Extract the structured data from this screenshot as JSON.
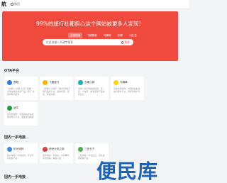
{
  "topbar": {
    "logo": "航",
    "home": "首页",
    "home_icon": "home-icon"
  },
  "hero": {
    "title": "99%的旅行社都担心这个网站被更多人发现！",
    "tabs": [
      "全部搜索",
      "飞猪搜索",
      "马蜂窝",
      "去哪",
      "小红书"
    ],
    "search_placeholder": "在此处输入关键字搜索",
    "search_button": "搜索",
    "bg_color": "#f04a3f"
  },
  "sections": {
    "ota": "OTA平台",
    "domestic": "国内一手地接",
    "domestic2": "国内一手地接"
  },
  "ota_cards": [
    {
      "name": "携程",
      "desc": "【去哪儿·中国·北京】携程·一手地接精选旅游产品，预订·线路攻略与服务",
      "color": "#2a7be4"
    },
    {
      "name": "飞猪旅行",
      "desc": "【去哪儿·中国】飞猪·阿里旗下旅行品牌平台，提供机票，酒店，旅游线路",
      "color": "#ffb400"
    },
    {
      "name": "去哪儿网",
      "desc": "去哪儿旅行网提供机票，酒店，火车票，旅游度假产品综合比价",
      "color": "#12b3a8"
    },
    {
      "name": "马蜂窝",
      "desc": "马蜂窝旅游网：中国领先的自由行服务平台，旅游攻略分享",
      "color": "#ffd200"
    },
    {
      "name": "途牛",
      "desc": "途牛旅游网：中国领先的在线旅游预订平台，跟团游自助游",
      "color": "#1b9e3e"
    }
  ],
  "domestic_cards": [
    {
      "name": "杭州双林",
      "desc": "杭州本地一手地接社，专注华东线路产品",
      "color": "#3a8ee6"
    },
    {
      "name": "西安长安之旅",
      "desc": "西安本地一手地接，兵马俑华清池线路，精品小团",
      "color": "#e23c3c"
    },
    {
      "name": "三亚天下",
      "desc": "三亚本地一手地接社，海岛度假线路产品",
      "color": "#4caf50"
    }
  ],
  "watermark": "便民库",
  "accent_color": "#f04a3f"
}
